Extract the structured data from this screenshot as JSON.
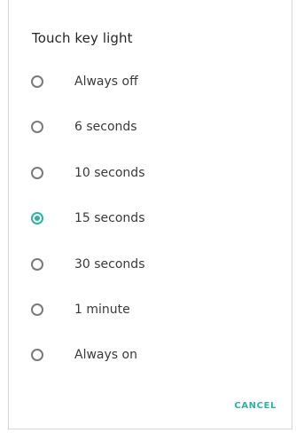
{
  "dialog": {
    "title": "Touch key light",
    "options": [
      {
        "label": "Always off",
        "selected": false
      },
      {
        "label": "6 seconds",
        "selected": false
      },
      {
        "label": "10 seconds",
        "selected": false
      },
      {
        "label": "15 seconds",
        "selected": true
      },
      {
        "label": "30 seconds",
        "selected": false
      },
      {
        "label": "1 minute",
        "selected": false
      },
      {
        "label": "Always on",
        "selected": false
      }
    ],
    "cancel_label": "CANCEL"
  },
  "colors": {
    "accent": "#2bb3a4",
    "radio_unchecked": "#7a7a7a",
    "text": "#3a3a3a"
  }
}
